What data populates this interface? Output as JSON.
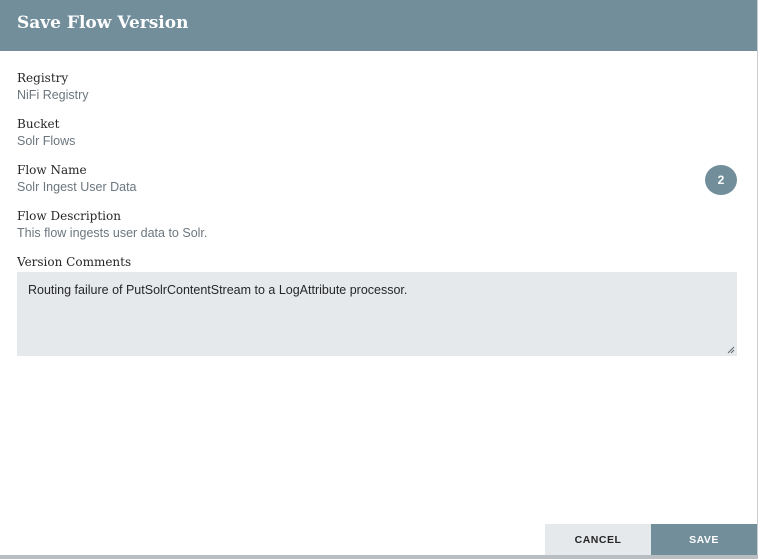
{
  "dialog": {
    "title": "Save Flow Version"
  },
  "fields": {
    "registry": {
      "label": "Registry",
      "value": "NiFi Registry"
    },
    "bucket": {
      "label": "Bucket",
      "value": "Solr Flows"
    },
    "flow_name": {
      "label": "Flow Name",
      "value": "Solr Ingest User Data"
    },
    "flow_description": {
      "label": "Flow Description",
      "value": "This flow ingests user data to Solr."
    },
    "version_comments": {
      "label": "Version Comments",
      "value": "Routing failure of PutSolrContentStream to a LogAttribute processor."
    }
  },
  "version_badge": "2",
  "buttons": {
    "cancel_label": "CANCEL",
    "save_label": "SAVE"
  },
  "colors": {
    "header": "#728e9b",
    "comments_bg": "#e6e9ec",
    "cancel_bg": "#e6e9ec",
    "save_bg": "#728e9b"
  }
}
